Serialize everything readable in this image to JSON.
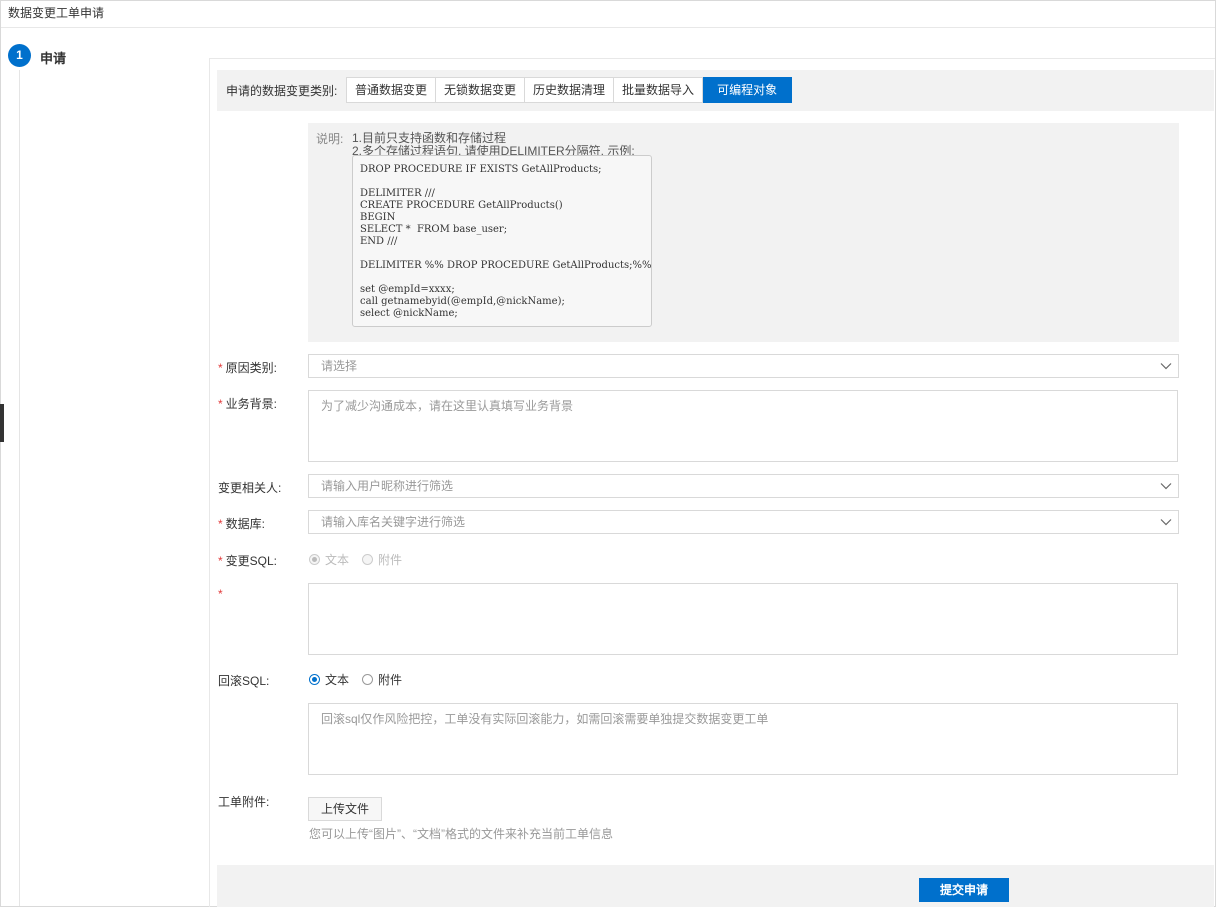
{
  "page_title": "数据变更工单申请",
  "step": {
    "number": "1",
    "label": "申请"
  },
  "change_type": {
    "label": "申请的数据变更类别:",
    "options": [
      "普通数据变更",
      "无锁数据变更",
      "历史数据清理",
      "批量数据导入",
      "可编程对象"
    ],
    "active": "可编程对象"
  },
  "note": {
    "label": "说明:",
    "line1": "1.目前只支持函数和存储过程",
    "line2": "2.多个存储过程语句, 请使用DELIMITER分隔符, 示例:",
    "code": "DROP PROCEDURE IF EXISTS GetAllProducts;\n\nDELIMITER ///\nCREATE PROCEDURE GetAllProducts()\nBEGIN\nSELECT *  FROM base_user;\nEND ///\n\nDELIMITER %% DROP PROCEDURE GetAllProducts;%%\n\nset @empId=xxxx;\ncall getnamebyid(@empId,@nickName);\nselect @nickName;"
  },
  "form": {
    "required_mark": "*",
    "reason": {
      "label": "原因类别:",
      "placeholder": "请选择"
    },
    "background": {
      "label": "业务背景:",
      "placeholder": "为了减少沟通成本，请在这里认真填写业务背景"
    },
    "stakeholders": {
      "label": "变更相关人:",
      "placeholder": "请输入用户昵称进行筛选"
    },
    "database": {
      "label": "数据库:",
      "placeholder": "请输入库名关键字进行筛选"
    },
    "change_sql": {
      "label": "变更SQL:",
      "option_text": "文本",
      "option_attachment": "附件",
      "selected": "文本",
      "disabled": true
    },
    "sql_text": {
      "placeholder": ""
    },
    "rollback_sql": {
      "label": "回滚SQL:",
      "option_text": "文本",
      "option_attachment": "附件",
      "selected": "文本",
      "placeholder": "回滚sql仅作风险把控，工单没有实际回滚能力，如需回滚需要单独提交数据变更工单"
    },
    "attachment": {
      "label": "工单附件:",
      "upload_label": "上传文件",
      "hint": "您可以上传“图片”、“文档”格式的文件来补充当前工单信息"
    }
  },
  "submit_label": "提交申请",
  "colors": {
    "primary": "#0070cc",
    "required": "#e23b3b",
    "panel_bg": "#f2f2f2"
  }
}
